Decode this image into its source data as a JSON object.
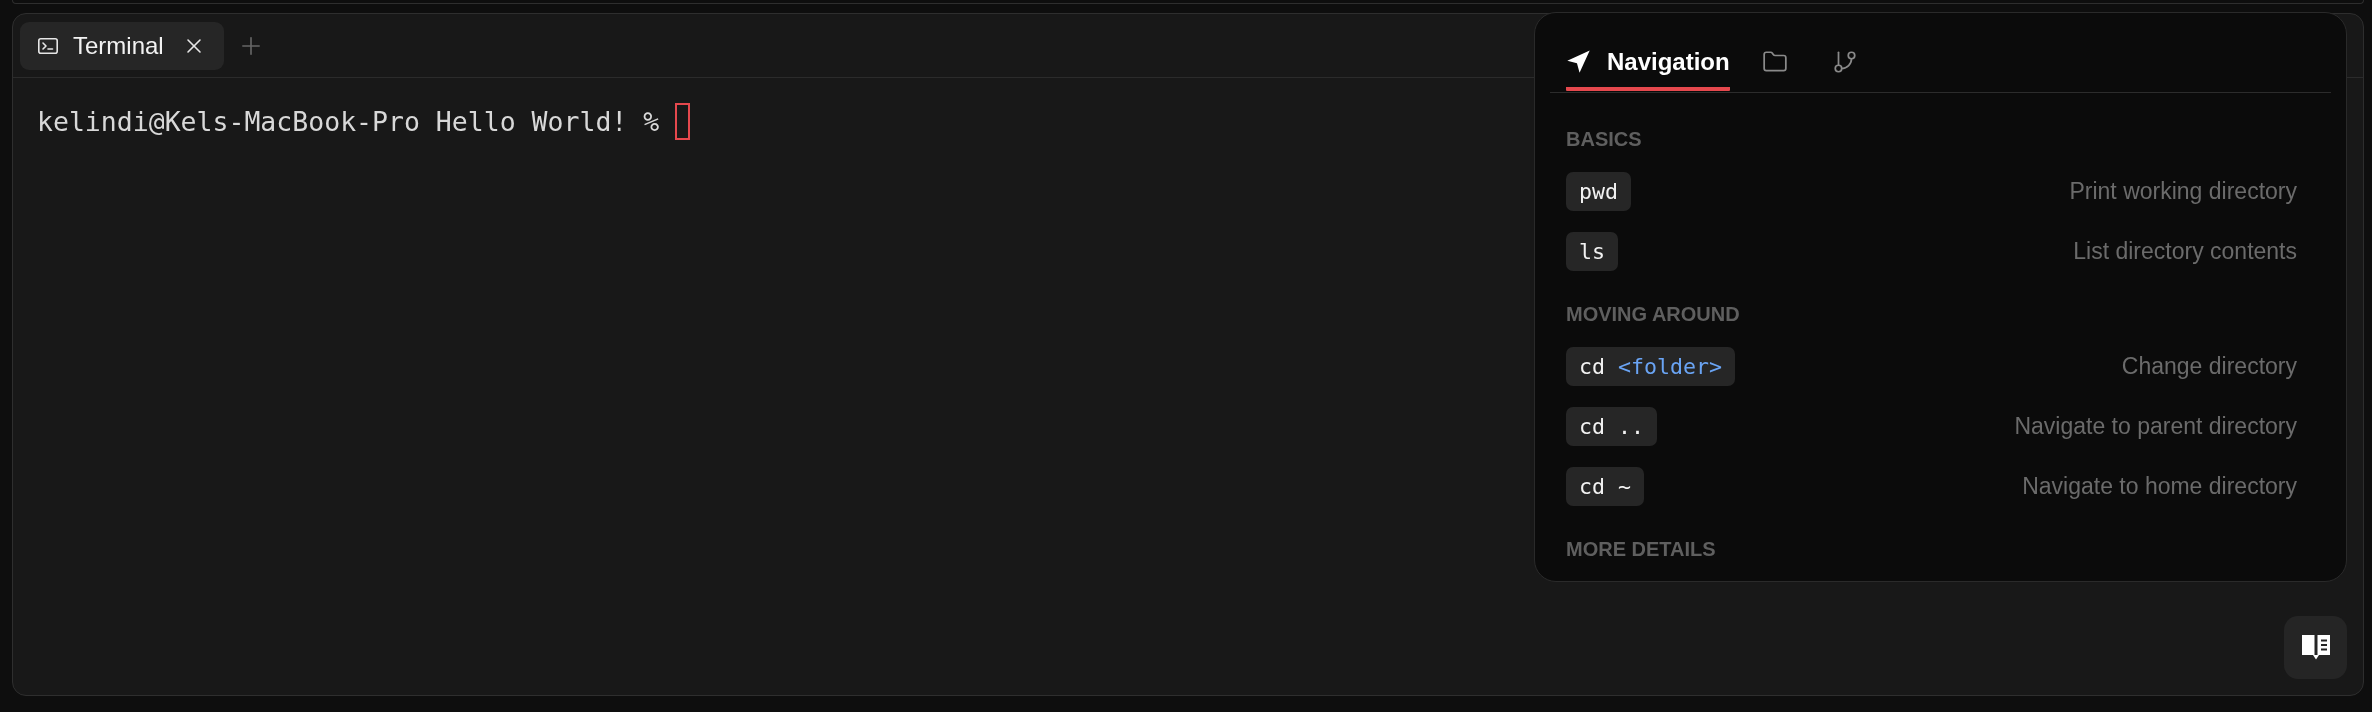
{
  "tabs": [
    {
      "label": "Terminal",
      "selected": true
    }
  ],
  "terminal": {
    "prompt": "kelindi@Kels-MacBook-Pro Hello World! %"
  },
  "reference_panel": {
    "tabs": [
      {
        "kind": "navigation",
        "label": "Navigation",
        "selected": true
      },
      {
        "kind": "folder",
        "selected": false
      },
      {
        "kind": "branch",
        "selected": false
      }
    ],
    "sections": [
      {
        "title": "BASICS",
        "commands": [
          {
            "command": "pwd",
            "description": "Print working directory"
          },
          {
            "command": "ls",
            "description": "List directory contents"
          }
        ]
      },
      {
        "title": "MOVING AROUND",
        "commands": [
          {
            "command": "cd",
            "argument": "<folder>",
            "description": "Change directory"
          },
          {
            "command": "cd ..",
            "description": "Navigate to parent directory"
          },
          {
            "command": "cd ~",
            "description": "Navigate to home directory"
          }
        ]
      },
      {
        "title": "MORE DETAILS"
      }
    ]
  }
}
